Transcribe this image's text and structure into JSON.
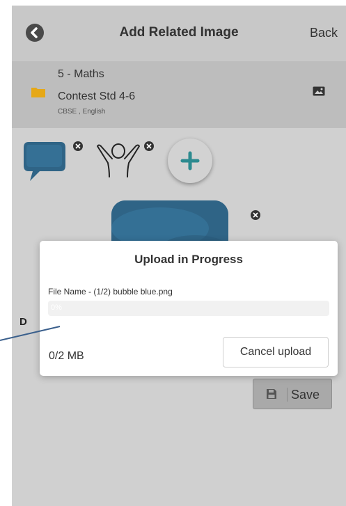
{
  "header": {
    "title": "Add Related Image",
    "back_label": "Back"
  },
  "folder": {
    "line1": "5 - Maths",
    "line2": "Contest Std 4-6",
    "meta": "CBSE , English"
  },
  "partial_label": "D",
  "save_label": "Save",
  "modal": {
    "title": "Upload in Progress",
    "file_name": "File Name - (1/2) bubble blue.png",
    "progress_percent": 0,
    "progress_text": "0%",
    "size_text": "0/2 MB",
    "cancel_label": "Cancel upload"
  },
  "icons": {
    "back": "chevron-left-circle-icon",
    "folder": "folder-icon",
    "image": "image-icon",
    "remove": "close-circle-icon",
    "add": "plus-icon",
    "save": "floppy-disk-icon"
  },
  "colors": {
    "overlay_gray": "#d0d0d0",
    "folder_yellow": "#e6a817",
    "accent_teal": "#2c8a8f",
    "bubble_blue": "#2f6486",
    "progress_blue": "#2a7ae2",
    "annotation_line": "#3a5f8c"
  }
}
